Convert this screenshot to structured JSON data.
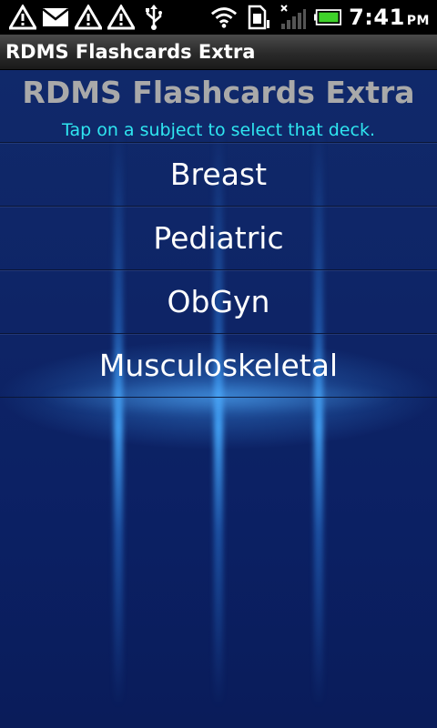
{
  "status_bar": {
    "time": "7:41",
    "ampm": "PM",
    "icons": [
      "alert-icon",
      "mail-icon",
      "alert-icon",
      "alert-icon",
      "usb-icon",
      "wifi-icon",
      "sim-card-icon",
      "signal-icon",
      "battery-icon"
    ]
  },
  "title_bar": {
    "title": "RDMS Flashcards Extra"
  },
  "main": {
    "title": "RDMS Flashcards Extra",
    "subtitle": "Tap on a subject to select that deck.",
    "decks": [
      {
        "label": "Breast"
      },
      {
        "label": "Pediatric"
      },
      {
        "label": "ObGyn"
      },
      {
        "label": "Musculoskeletal"
      }
    ]
  },
  "colors": {
    "status_bar_bg": "#000000",
    "title_bar_bg": "#2a2a2a",
    "background": "#0e2466",
    "app_title": "#a9a9a9",
    "subtitle": "#2fe6f0",
    "deck_text": "#ffffff",
    "battery": "#3fd22a"
  }
}
